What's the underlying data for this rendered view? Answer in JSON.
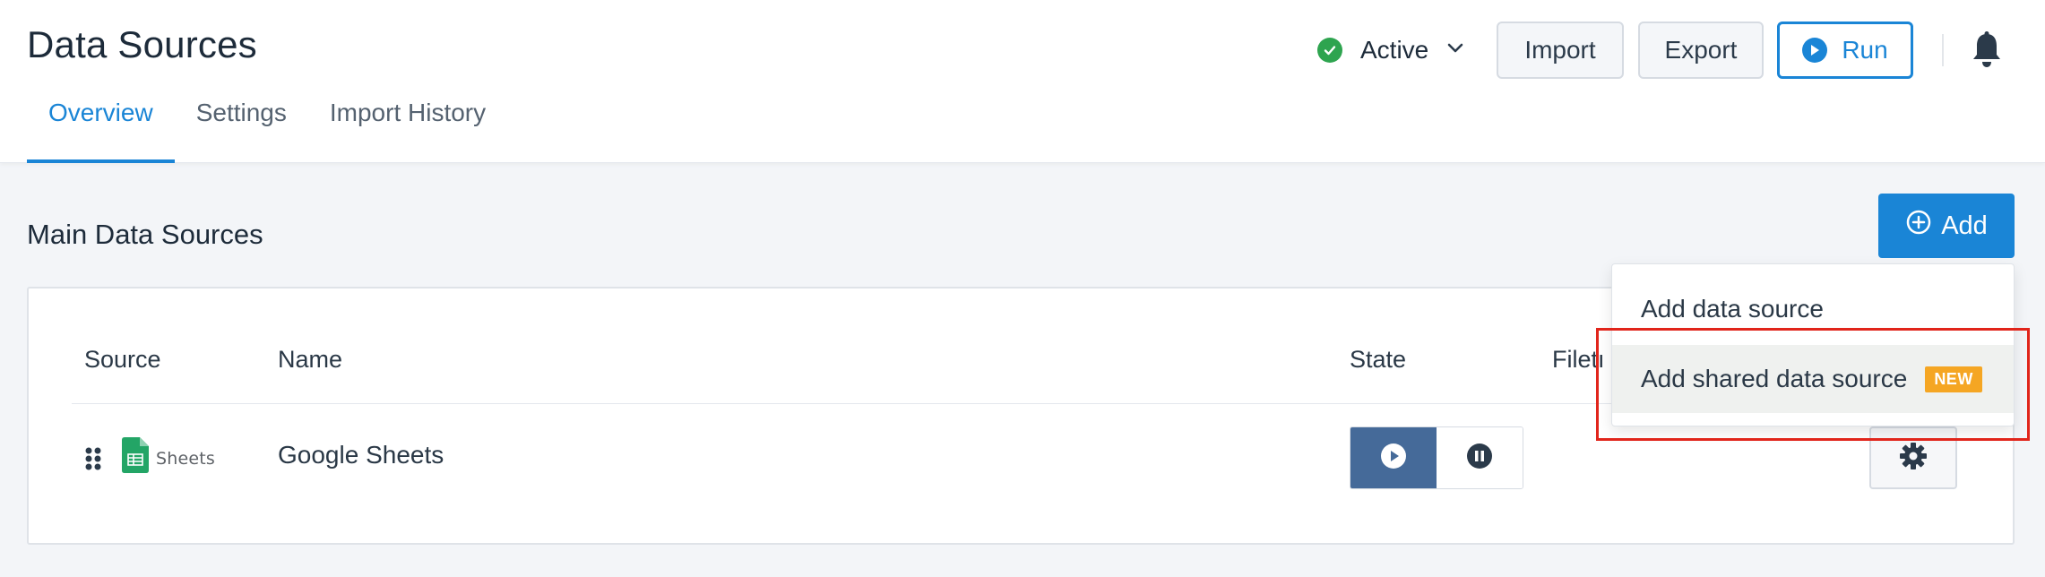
{
  "header": {
    "title": "Data Sources",
    "status": {
      "label": "Active",
      "color": "#2ea44f"
    },
    "buttons": {
      "import": "Import",
      "export": "Export",
      "run": "Run"
    }
  },
  "tabs": [
    {
      "label": "Overview",
      "active": true
    },
    {
      "label": "Settings",
      "active": false
    },
    {
      "label": "Import History",
      "active": false
    }
  ],
  "section": {
    "title": "Main Data Sources",
    "add_label": "Add"
  },
  "table": {
    "columns": [
      "Source",
      "Name",
      "State",
      "Filetı"
    ],
    "rows": [
      {
        "source_icon": "google-sheets-icon",
        "source_text": "Sheets",
        "name": "Google Sheets",
        "state": "running"
      }
    ]
  },
  "dropdown": {
    "items": [
      {
        "label": "Add data source"
      },
      {
        "label": "Add shared data source",
        "badge": "NEW"
      }
    ]
  },
  "colors": {
    "accent": "#1a85d6",
    "badge": "#f5a623",
    "highlight": "#e1251b",
    "toggle_on": "#456a99"
  }
}
